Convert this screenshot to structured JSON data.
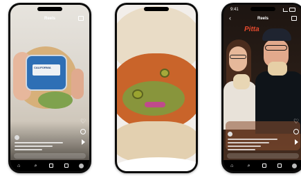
{
  "phones": [
    {
      "id": "phone-1",
      "status_time": "",
      "top_title": "Reels",
      "can_brand": "CALIFORNIA",
      "caption_user": "",
      "nav_icons": [
        "home-icon",
        "search-icon",
        "reels-icon",
        "shop-icon",
        "profile-avatar"
      ]
    },
    {
      "id": "phone-2"
    },
    {
      "id": "phone-3",
      "status_time": "9:41",
      "top_title": "Reels",
      "sign_text": "Pitta",
      "nav_icons": [
        "home-icon",
        "search-icon",
        "reels-icon",
        "shop-icon",
        "profile-avatar"
      ]
    }
  ],
  "icons": {
    "heart": "♡",
    "home": "⌂",
    "search": "⌕",
    "back": "‹"
  }
}
